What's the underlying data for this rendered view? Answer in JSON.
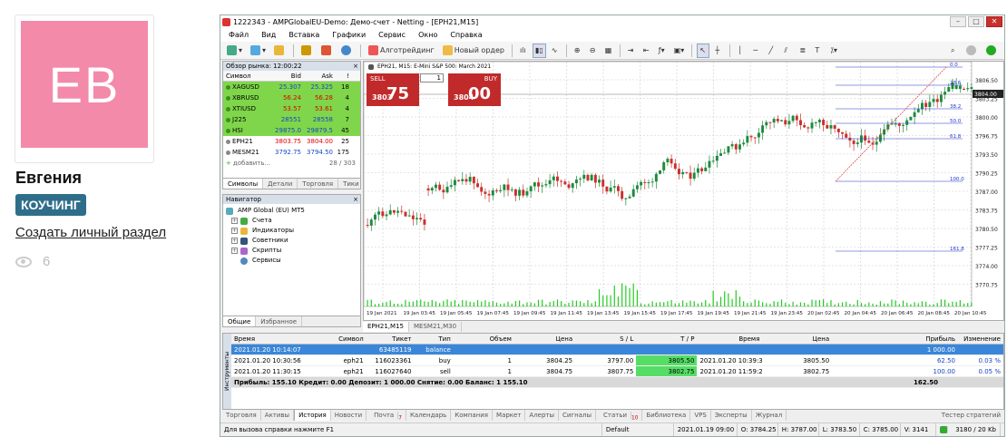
{
  "profile": {
    "initials": "EB",
    "avatar_color": "#f38aa9",
    "name": "Евгения",
    "badge": "КОУЧИНГ",
    "link": "Создать личный раздел",
    "views": "6"
  },
  "window": {
    "title": "1222343 - AMPGlobalEU-Demo: Демо-счет - Netting - [EPH21,M15]",
    "menu": [
      "Файл",
      "Вид",
      "Вставка",
      "Графики",
      "Сервис",
      "Окно",
      "Справка"
    ],
    "toolbar": {
      "algo": "Алготрейдинг",
      "new_order": "Новый ордер"
    }
  },
  "market_watch": {
    "title": "Обзор рынка: 12:00:22",
    "headers": [
      "Символ",
      "Bid",
      "Ask",
      "!"
    ],
    "rows": [
      {
        "sym": "XAGUSD",
        "bid": "25.307",
        "ask": "25.325",
        "n": "18",
        "hl": true,
        "bidred": false
      },
      {
        "sym": "XBRUSD",
        "bid": "56.24",
        "ask": "56.28",
        "n": "4",
        "hl": true,
        "bidred": true
      },
      {
        "sym": "XTIUSD",
        "bid": "53.57",
        "ask": "53.61",
        "n": "4",
        "hl": true,
        "bidred": true
      },
      {
        "sym": "J225",
        "bid": "28551",
        "ask": "28558",
        "n": "7",
        "hl": true,
        "bidred": false
      },
      {
        "sym": "HSI",
        "bid": "29875.0",
        "ask": "29879.5",
        "n": "45",
        "hl": true,
        "bidred": false
      },
      {
        "sym": "EPH21",
        "bid": "3803.75",
        "ask": "3804.00",
        "n": "25",
        "hl": false,
        "bidred": true
      },
      {
        "sym": "MESM21",
        "bid": "3792.75",
        "ask": "3794.50",
        "n": "175",
        "hl": false,
        "bidred": false
      }
    ],
    "add": "добавить...",
    "count": "28 / 303",
    "tabs": [
      "Символы",
      "Детали",
      "Торговля",
      "Тики"
    ]
  },
  "navigator": {
    "title": "Навигатор",
    "root": "AMP Global (EU) MT5",
    "items": [
      "Счета",
      "Индикаторы",
      "Советники",
      "Скрипты",
      "Сервисы"
    ],
    "tabs": [
      "Общие",
      "Избранное"
    ]
  },
  "chart": {
    "label": "EPH21, M15:  E-Mini S&P 500: March 2021",
    "sell": "SELL",
    "buy": "BUY",
    "lot": "1",
    "sell_small": "3803",
    "sell_big": "75",
    "buy_small": "3804",
    "buy_big": "00",
    "price_labels": [
      "3806.50",
      "3803.25",
      "3800.00",
      "3796.75",
      "3793.50",
      "3790.25",
      "3787.00",
      "3783.75",
      "3780.50",
      "3777.25",
      "3774.00",
      "3770.75"
    ],
    "current_price": "3804.00",
    "fib_labels": [
      "0.0",
      "23.6",
      "38.2",
      "50.0",
      "61.8",
      "100.0",
      "161.8"
    ],
    "time_labels": [
      "19 Jan 2021",
      "19 Jan 03:45",
      "19 Jan 05:45",
      "19 Jan 07:45",
      "19 Jan 09:45",
      "19 Jan 11:45",
      "19 Jan 13:45",
      "19 Jan 15:45",
      "19 Jan 17:45",
      "19 Jan 19:45",
      "19 Jan 21:45",
      "19 Jan 23:45",
      "20 Jan 02:45",
      "20 Jan 04:45",
      "20 Jan 06:45",
      "20 Jan 08:45",
      "20 Jan 10:45"
    ],
    "tabs": [
      "EPH21,M15",
      "MESM21,M30"
    ],
    "colors": {
      "up": "#1e8a3c",
      "down": "#c9302c",
      "fib": "#2233cc",
      "volume": "#22cc22"
    }
  },
  "terminal": {
    "side": "Инструменты",
    "headers": [
      "Время",
      "Символ",
      "Тикет",
      "Тип",
      "Объем",
      "Цена",
      "S / L",
      "T / P",
      "Время",
      "Цена",
      "Прибыль",
      "Изменение"
    ],
    "rows": [
      {
        "time": "2021.01.20 10:14:07",
        "sym": "",
        "ticket": "63485119",
        "type": "balance",
        "vol": "",
        "price": "",
        "sl": "",
        "tp": "",
        "time2": "",
        "price2": "",
        "profit": "1 000.00",
        "chg": ""
      },
      {
        "time": "2021.01.20 10:30:56",
        "sym": "eph21",
        "ticket": "116023361",
        "type": "buy",
        "vol": "1",
        "price": "3804.25",
        "sl": "3797.00",
        "tp": "3805.50",
        "time2": "2021.01.20 10:39:38",
        "price2": "3805.50",
        "profit": "62.50",
        "chg": "0.03 %"
      },
      {
        "time": "2021.01.20 11:30:15",
        "sym": "eph21",
        "ticket": "116027640",
        "type": "sell",
        "vol": "1",
        "price": "3804.75",
        "sl": "3807.75",
        "tp": "3802.75",
        "time2": "2021.01.20 11:59:23",
        "price2": "3802.75",
        "profit": "100.00",
        "chg": "0.05 %"
      }
    ],
    "total": "Прибыль: 155.10  Кредит: 0.00  Депозит: 1 000.00  Снятие: 0.00  Баланс: 1 155.10",
    "total_profit": "162.50",
    "tabs": [
      "Торговля",
      "Активы",
      "История",
      "Новости",
      "Почта",
      "Календарь",
      "Компания",
      "Маркет",
      "Алерты",
      "Сигналы",
      "Статьи",
      "Библиотека",
      "VPS",
      "Эксперты",
      "Журнал"
    ],
    "mail_count": "7",
    "articles_count": "10",
    "tester": "Тестер стратегий"
  },
  "status": {
    "help": "Для вызова справки нажмите F1",
    "profile": "Default",
    "datetime": "2021.01.19 09:00",
    "o": "O: 3784.25",
    "h": "H: 3787.00",
    "l": "L: 3783.50",
    "c": "C: 3785.00",
    "v": "V: 3141",
    "traffic": "3180 / 20 Kb"
  }
}
